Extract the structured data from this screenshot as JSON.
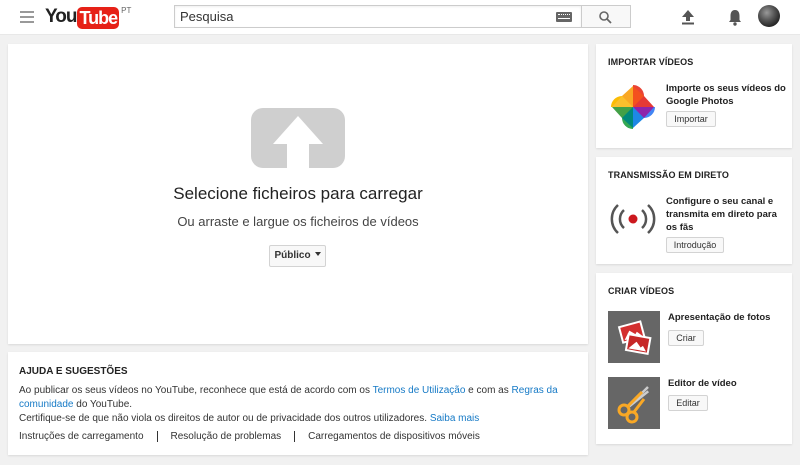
{
  "header": {
    "logo_you": "You",
    "logo_tube": "Tube",
    "logo_country": "PT",
    "search_placeholder": "Pesquisa"
  },
  "upload": {
    "title": "Selecione ficheiros para carregar",
    "subtitle": "Ou arraste e largue os ficheiros de vídeos",
    "privacy_label": "Público"
  },
  "help": {
    "title": "AJUDA E SUGESTÕES",
    "text_1": "Ao publicar os seus vídeos no YouTube, reconhece que está de acordo com os ",
    "terms_link": "Termos de Utilização",
    "text_2": " e com as ",
    "guidelines_link": "Regras da comunidade",
    "text_3": " do YouTube.",
    "text_4": "Certifique-se de que não viola os direitos de autor ou de privacidade dos outros utilizadores. ",
    "learn_more_link": "Saiba mais",
    "links": [
      "Instruções de carregamento",
      "Resolução de problemas",
      "Carregamentos de dispositivos móveis"
    ]
  },
  "sidebar": {
    "import": {
      "title": "IMPORTAR VÍDEOS",
      "text": "Importe os seus vídeos do Google Photos",
      "button": "Importar"
    },
    "live": {
      "title": "TRANSMISSÃO EM DIRETO",
      "text": "Configure o seu canal e transmita em direto para os fãs",
      "button": "Introdução"
    },
    "create": {
      "title": "CRIAR VÍDEOS",
      "photos_label": "Apresentação de fotos",
      "photos_button": "Criar",
      "editor_label": "Editor de vídeo",
      "editor_button": "Editar"
    }
  },
  "colors": {
    "brand_red": "#e62117",
    "link_blue": "#167ac6",
    "background": "#f1f1f1"
  },
  "icons": [
    "menu-icon",
    "keyboard-icon",
    "search-icon",
    "upload-icon",
    "bell-icon",
    "upload-arrow-icon",
    "google-photos-icon",
    "live-broadcast-icon",
    "photo-slideshow-icon",
    "scissors-icon"
  ]
}
